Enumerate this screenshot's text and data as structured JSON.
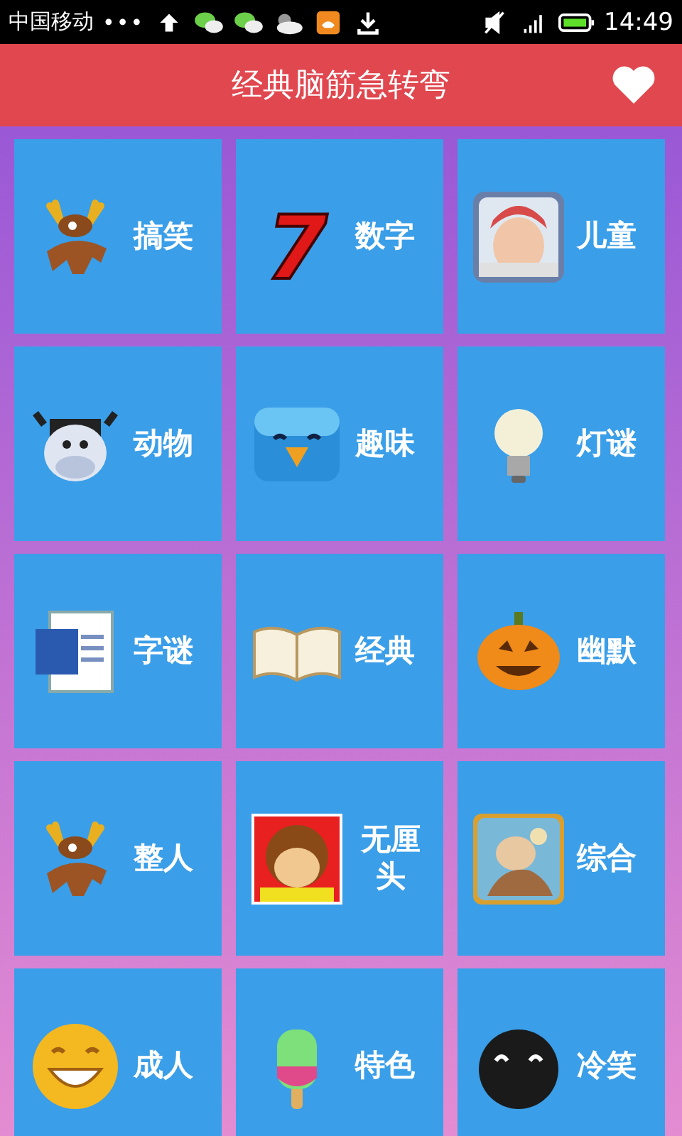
{
  "status_bar": {
    "carrier": "中国移动",
    "dots": "•••",
    "time": "14:49"
  },
  "header": {
    "title": "经典脑筋急转弯"
  },
  "categories": [
    {
      "label": "搞笑"
    },
    {
      "label": "数字",
      "glyph": "7"
    },
    {
      "label": "儿童",
      "kind": "picture"
    },
    {
      "label": "动物"
    },
    {
      "label": "趣味"
    },
    {
      "label": "灯谜"
    },
    {
      "label": "字谜"
    },
    {
      "label": "经典"
    },
    {
      "label": "幽默"
    },
    {
      "label": "整人"
    },
    {
      "label": "无厘头"
    },
    {
      "label": "综合",
      "kind": "picture"
    },
    {
      "label": "成人"
    },
    {
      "label": "特色"
    },
    {
      "label": "冷笑"
    }
  ]
}
